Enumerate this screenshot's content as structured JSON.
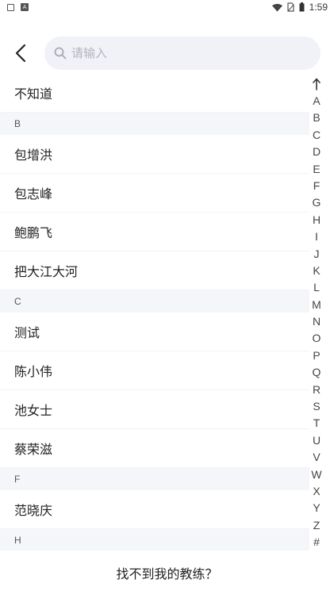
{
  "status_bar": {
    "time": "1:59",
    "icons": [
      "notification-box-icon",
      "notification-a-icon",
      "wifi-icon",
      "no-sim-icon",
      "battery-icon"
    ]
  },
  "header": {
    "back_icon": "chevron-left-icon",
    "search": {
      "placeholder": "请输入",
      "value": ""
    }
  },
  "list": [
    {
      "type": "item",
      "name": "不知道"
    },
    {
      "type": "section",
      "letter": "B"
    },
    {
      "type": "item",
      "name": "包增洪"
    },
    {
      "type": "item",
      "name": "包志峰"
    },
    {
      "type": "item",
      "name": "鲍鹏飞"
    },
    {
      "type": "item",
      "name": "把大江大河"
    },
    {
      "type": "section",
      "letter": "C"
    },
    {
      "type": "item",
      "name": "测试"
    },
    {
      "type": "item",
      "name": "陈小伟"
    },
    {
      "type": "item",
      "name": "池女士"
    },
    {
      "type": "item",
      "name": "蔡荣滋"
    },
    {
      "type": "section",
      "letter": "F"
    },
    {
      "type": "item",
      "name": "范晓庆"
    },
    {
      "type": "section",
      "letter": "H"
    }
  ],
  "alpha_index": {
    "top_icon": "arrow-up-icon",
    "letters": [
      "A",
      "B",
      "C",
      "D",
      "E",
      "F",
      "G",
      "H",
      "I",
      "J",
      "K",
      "L",
      "M",
      "N",
      "O",
      "P",
      "Q",
      "R",
      "S",
      "T",
      "U",
      "V",
      "W",
      "X",
      "Y",
      "Z",
      "#"
    ]
  },
  "footer": {
    "link_label": "找不到我的教练？"
  }
}
